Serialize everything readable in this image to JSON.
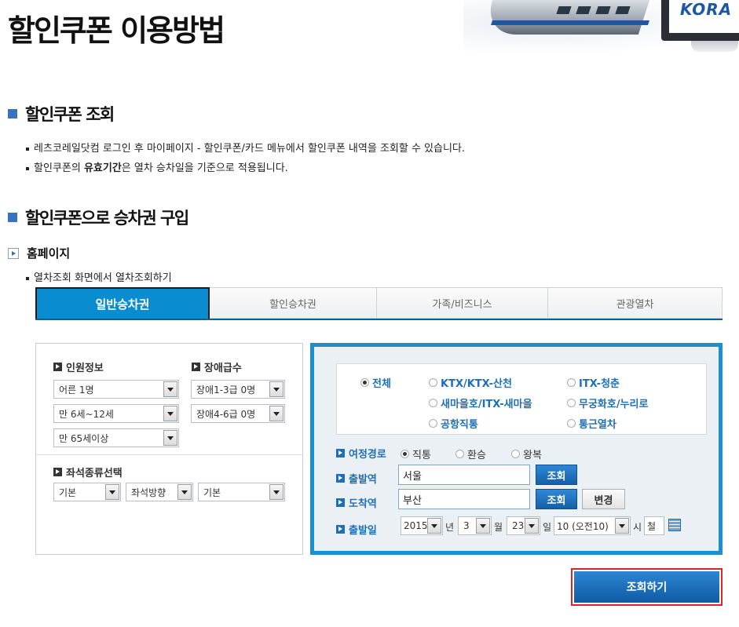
{
  "page": {
    "title": "할인쿠폰 이용방법",
    "logo_text": "KORA"
  },
  "section1": {
    "heading": "할인쿠폰 조회",
    "bullets": [
      {
        "text": "레츠코레일닷컴 로그인 후 마이페이지 - 할인쿠폰/카드 메뉴에서 할인쿠폰 내역을 조회할 수 있습니다."
      },
      {
        "prefix": "할인쿠폰의 ",
        "bold": "유효기간",
        "suffix": "은 열차 승차일을 기준으로 적용됩니다."
      }
    ]
  },
  "section2": {
    "heading": "할인쿠폰으로 승차권 구입",
    "subheading": "홈페이지",
    "bullet": "열차조회 화면에서 열차조회하기"
  },
  "tabs": [
    {
      "label": "일반승차권",
      "active": true
    },
    {
      "label": "할인승차권",
      "active": false
    },
    {
      "label": "가족/비즈니스",
      "active": false
    },
    {
      "label": "관광열차",
      "active": false
    }
  ],
  "left_panel": {
    "passenger_label": "인원정보",
    "disabled_label": "장애급수",
    "passenger_selects": [
      "어른 1명",
      "만 6세~12세",
      "만 65세이상"
    ],
    "disabled_selects": [
      "장애1-3급 0명",
      "장애4-6급 0명"
    ],
    "seat_label": "좌석종류선택",
    "seat_selects": [
      "기본",
      "좌석방향",
      "기본"
    ]
  },
  "right_panel": {
    "train_types": [
      {
        "label": "전체",
        "selected": true
      },
      {
        "label": "KTX/KTX-산천",
        "selected": false
      },
      {
        "label": "ITX-청춘",
        "selected": false
      },
      {
        "label": "새마을호/ITX-새마을",
        "selected": false
      },
      {
        "label": "무궁화호/누리로",
        "selected": false
      },
      {
        "label": "공항직통",
        "selected": false
      },
      {
        "label": "통근열차",
        "selected": false
      }
    ],
    "route_label": "여정경로",
    "route_options": [
      {
        "label": "직통",
        "selected": true
      },
      {
        "label": "환승",
        "selected": false
      },
      {
        "label": "왕복",
        "selected": false
      }
    ],
    "departure_label": "출발역",
    "departure_value": "서울",
    "arrival_label": "도착역",
    "arrival_value": "부산",
    "lookup_label": "조회",
    "swap_label": "변경",
    "date_label": "출발일",
    "year": "2015",
    "year_unit": "년",
    "month": "3",
    "month_unit": "월",
    "day": "23",
    "day_unit": "일",
    "hour": "10 (오전10)",
    "hour_unit": "시",
    "extra": "철"
  },
  "search_button": "조회하기",
  "colors": {
    "accent_blue": "#1c8fd1",
    "tab_active": "#0a8dd0",
    "button_blue": "#145fa8",
    "highlight_red": "#e0232b"
  }
}
